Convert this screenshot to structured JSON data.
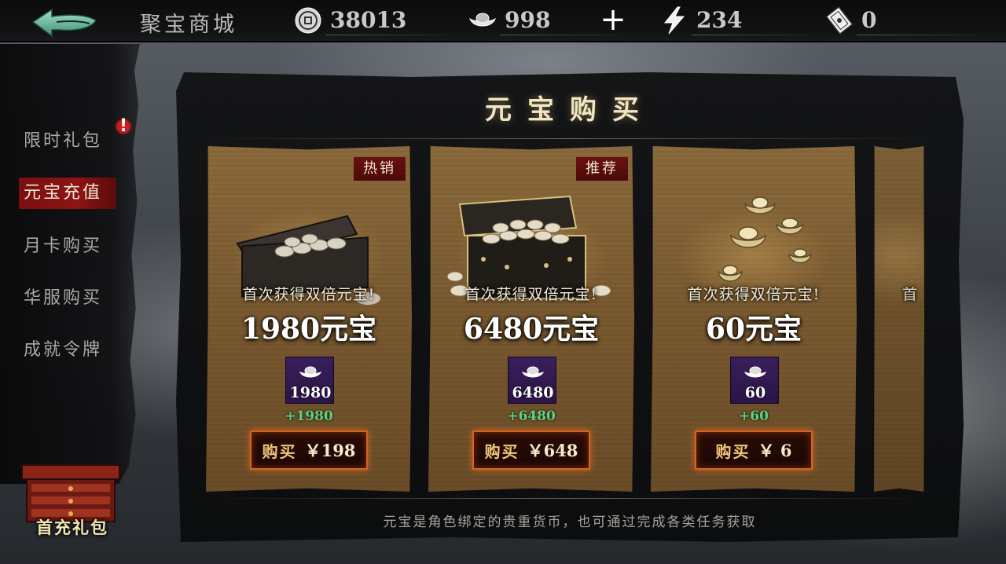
{
  "header": {
    "title": "聚宝商城",
    "resources": [
      {
        "name": "copper-coin",
        "icon": "coin-icon",
        "value": "38013"
      },
      {
        "name": "silver-ingot",
        "icon": "ingot-icon",
        "value": "998"
      },
      {
        "name": "stamina",
        "icon": "lightning-icon",
        "value": "234"
      },
      {
        "name": "ticket",
        "icon": "ticket-icon",
        "value": "0"
      }
    ],
    "plus_label": "+"
  },
  "sidebar": {
    "items": [
      {
        "label": "限时礼包",
        "active": false,
        "has_alert": true
      },
      {
        "label": "元宝充值",
        "active": true,
        "has_alert": false
      },
      {
        "label": "月卡购买",
        "active": false,
        "has_alert": false
      },
      {
        "label": "华服购买",
        "active": false,
        "has_alert": false
      },
      {
        "label": "成就令牌",
        "active": false,
        "has_alert": false
      }
    ],
    "alert_badge": "!",
    "gift": {
      "label": "首充礼包"
    }
  },
  "panel": {
    "title": "元宝购买",
    "footer": "元宝是角色绑定的贵重货币，也可通过完成各类任务获取",
    "cards": [
      {
        "tag": "热销",
        "promo": "首次获得双倍元宝!",
        "amount": "1980元宝",
        "slot_count": "1980",
        "bonus": "+1980",
        "buy_label": "购买",
        "price": "￥198"
      },
      {
        "tag": "推荐",
        "promo": "首次获得双倍元宝!",
        "amount": "6480元宝",
        "slot_count": "6480",
        "bonus": "+6480",
        "buy_label": "购买",
        "price": "￥648"
      },
      {
        "tag": "",
        "promo": "首次获得双倍元宝!",
        "amount": "60元宝",
        "slot_count": "60",
        "bonus": "+60",
        "buy_label": "购买",
        "price": "￥ 6"
      },
      {
        "tag": "",
        "promo": "首",
        "amount": "",
        "slot_count": "",
        "bonus": "",
        "buy_label": "",
        "price": ""
      }
    ]
  },
  "colors": {
    "active_tab": "#8d1414",
    "bonus_green": "#5fd27a",
    "buy_border": "#d9621e",
    "slot_purple": "#3a1f5c"
  }
}
